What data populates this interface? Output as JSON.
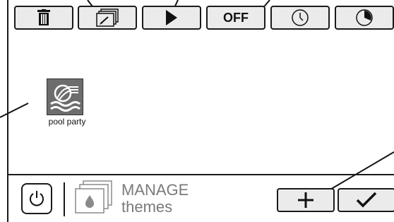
{
  "toolbar": {
    "buttons": [
      {
        "icon": "trash-icon"
      },
      {
        "icon": "edit-icon"
      },
      {
        "icon": "play-icon"
      },
      {
        "label": "OFF",
        "icon": "off-label"
      },
      {
        "icon": "clock-icon"
      },
      {
        "icon": "timer-icon"
      }
    ]
  },
  "themes": [
    {
      "name": "pool party",
      "icon": "pool-party-icon"
    }
  ],
  "footer": {
    "title_line1": "MANAGE",
    "title_line2": "themes",
    "add_icon": "plus-icon",
    "confirm_icon": "check-icon"
  },
  "colors": {
    "button_bg": "#ebebeb",
    "border": "#1a1a1a",
    "muted_text": "#7a7a7a",
    "tile_bg": "#6d6d6d"
  }
}
